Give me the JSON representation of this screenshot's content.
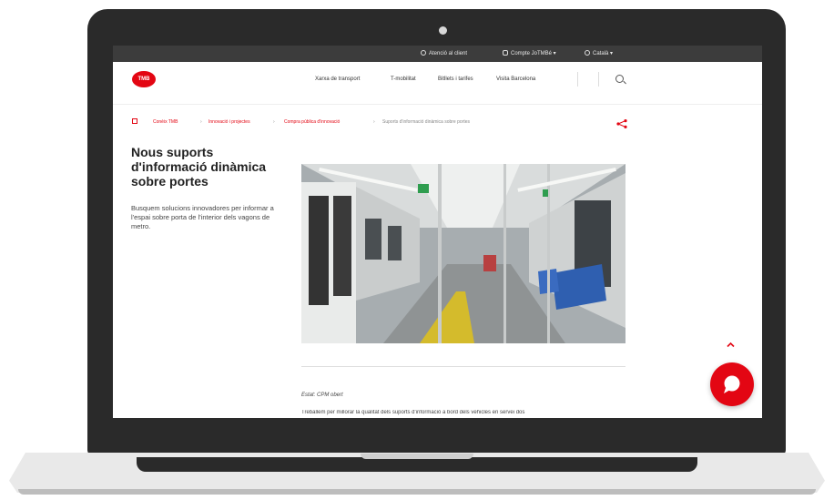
{
  "topbar": {
    "customer_service": "Atenció al client",
    "account": "Compte JoTMBé",
    "language": "Català"
  },
  "header": {
    "logo_text": "TMB",
    "nav": [
      "Xarxa de transport",
      "T-mobilitat",
      "Bitllets i tarifes",
      "Visita Barcelona"
    ]
  },
  "breadcrumb": {
    "items": [
      "Conèix TMB",
      "Innovació i projectes",
      "Compra pública d'innovació"
    ],
    "current": "Suports d'informació dinàmica sobre portes"
  },
  "article": {
    "title": "Nous suports d'informació dinàmica sobre portes",
    "lead": "Busquem solucions innovadores per informar a l'espai sobre porta de l'interior dels vagons de metro.",
    "estat": "Estat: CPM obert",
    "paragraph": "Treballem per millorar la qualitat dels suports d'informació a bord dels vehicles en servei dos"
  },
  "colors": {
    "accent": "#e30613",
    "topbar": "#3c3c3c",
    "frame": "#2a2a2a"
  },
  "icons": [
    "clock-icon",
    "user-icon",
    "globe-icon",
    "search-icon",
    "home-icon",
    "share-icon",
    "chevron-up-icon",
    "chat-icon"
  ]
}
